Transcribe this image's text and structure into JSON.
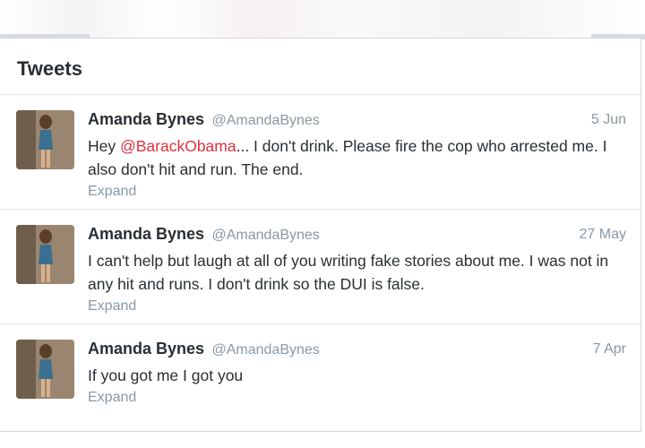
{
  "section_title": "Tweets",
  "tweets": [
    {
      "name": "Amanda Bynes",
      "handle": "@AmandaBynes",
      "date": "5 Jun",
      "text_before": "Hey ",
      "mention": "@BarackObama",
      "text_after": "... I don't drink. Please fire the cop who arrested me. I also don't hit and run. The end.",
      "expand": "Expand"
    },
    {
      "name": "Amanda Bynes",
      "handle": "@AmandaBynes",
      "date": "27 May",
      "text": "I can't help but laugh at all of you writing fake stories about me. I was not in any hit and runs. I don't drink so the DUI is false.",
      "expand": "Expand"
    },
    {
      "name": "Amanda Bynes",
      "handle": "@AmandaBynes",
      "date": "7 Apr",
      "text": "If you got me I got you",
      "expand": "Expand"
    }
  ],
  "colors": {
    "name": "#292f33",
    "muted": "#8899a6",
    "mention": "#e0303e"
  }
}
